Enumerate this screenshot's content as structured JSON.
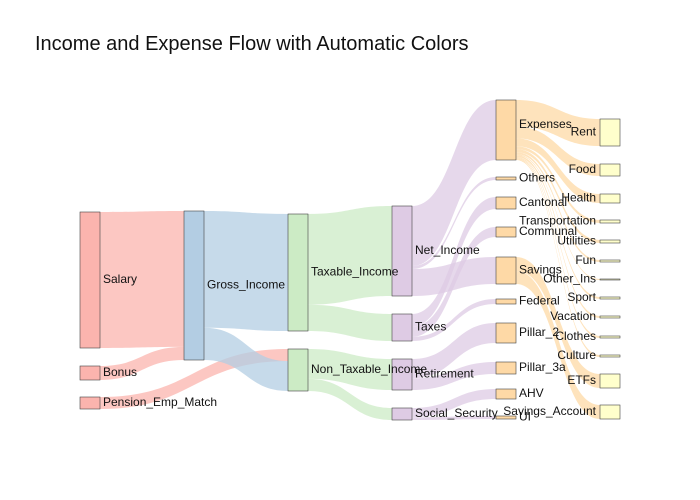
{
  "chart_data": {
    "type": "sankey",
    "title": "Income and Expense Flow with Automatic Colors",
    "nodes": [
      {
        "id": "Salary",
        "label": "Salary",
        "color": "#fbb4ae"
      },
      {
        "id": "Bonus",
        "label": "Bonus",
        "color": "#fbb4ae"
      },
      {
        "id": "Pension_Emp_Match",
        "label": "Pension_Emp_Match",
        "color": "#fbb4ae"
      },
      {
        "id": "Gross_Income",
        "label": "Gross_Income",
        "color": "#b3cde3"
      },
      {
        "id": "Taxable_Income",
        "label": "Taxable_Income",
        "color": "#ccebc5"
      },
      {
        "id": "Non_Taxable_Income",
        "label": "Non_Taxable_Income",
        "color": "#ccebc5"
      },
      {
        "id": "Net_Income",
        "label": "Net_Income",
        "color": "#decbe4"
      },
      {
        "id": "Taxes",
        "label": "Taxes",
        "color": "#decbe4"
      },
      {
        "id": "Retirement",
        "label": "Retirement",
        "color": "#decbe4"
      },
      {
        "id": "Social_Security",
        "label": "Social_Security",
        "color": "#decbe4"
      },
      {
        "id": "Expenses",
        "label": "Expenses",
        "color": "#fed9a6"
      },
      {
        "id": "Others",
        "label": "Others",
        "color": "#fed9a6"
      },
      {
        "id": "Cantonal",
        "label": "Cantonal",
        "color": "#fed9a6"
      },
      {
        "id": "Communal",
        "label": "Communal",
        "color": "#fed9a6"
      },
      {
        "id": "Savings",
        "label": "Savings",
        "color": "#fed9a6"
      },
      {
        "id": "Federal",
        "label": "Federal",
        "color": "#fed9a6"
      },
      {
        "id": "Pillar_2",
        "label": "Pillar_2",
        "color": "#fed9a6"
      },
      {
        "id": "Pillar_3a",
        "label": "Pillar_3a",
        "color": "#fed9a6"
      },
      {
        "id": "AHV",
        "label": "AHV",
        "color": "#fed9a6"
      },
      {
        "id": "UI",
        "label": "UI",
        "color": "#fed9a6"
      },
      {
        "id": "Rent",
        "label": "Rent",
        "color": "#ffffcc"
      },
      {
        "id": "Food",
        "label": "Food",
        "color": "#ffffcc"
      },
      {
        "id": "Health",
        "label": "Health",
        "color": "#ffffcc"
      },
      {
        "id": "Transportation",
        "label": "Transportation",
        "color": "#ffffcc"
      },
      {
        "id": "Utilities",
        "label": "Utilities",
        "color": "#ffffcc"
      },
      {
        "id": "Fun",
        "label": "Fun",
        "color": "#ffffcc"
      },
      {
        "id": "Other_Ins",
        "label": "Other_Ins",
        "color": "#ffffcc"
      },
      {
        "id": "Sport",
        "label": "Sport",
        "color": "#ffffcc"
      },
      {
        "id": "Vacation",
        "label": "Vacation",
        "color": "#ffffcc"
      },
      {
        "id": "Clothes",
        "label": "Clothes",
        "color": "#ffffcc"
      },
      {
        "id": "Culture",
        "label": "Culture",
        "color": "#ffffcc"
      },
      {
        "id": "ETFs",
        "label": "ETFs",
        "color": "#ffffcc"
      },
      {
        "id": "Savings_Account",
        "label": "Savings_Account",
        "color": "#ffffcc"
      }
    ],
    "links": [
      {
        "source": "Salary",
        "target": "Gross_Income",
        "value": 135
      },
      {
        "source": "Bonus",
        "target": "Gross_Income",
        "value": 13
      },
      {
        "source": "Pension_Emp_Match",
        "target": "Non_Taxable_Income",
        "value": 13
      },
      {
        "source": "Gross_Income",
        "target": "Taxable_Income",
        "value": 116
      },
      {
        "source": "Gross_Income",
        "target": "Non_Taxable_Income",
        "value": 32
      },
      {
        "source": "Taxable_Income",
        "target": "Net_Income",
        "value": 90
      },
      {
        "source": "Taxable_Income",
        "target": "Taxes",
        "value": 26
      },
      {
        "source": "Non_Taxable_Income",
        "target": "Retirement",
        "value": 32
      },
      {
        "source": "Non_Taxable_Income",
        "target": "Social_Security",
        "value": 13
      },
      {
        "source": "Net_Income",
        "target": "Expenses",
        "value": 60
      },
      {
        "source": "Net_Income",
        "target": "Others",
        "value": 3
      },
      {
        "source": "Net_Income",
        "target": "Savings",
        "value": 27
      },
      {
        "source": "Taxes",
        "target": "Cantonal",
        "value": 12
      },
      {
        "source": "Taxes",
        "target": "Communal",
        "value": 10
      },
      {
        "source": "Taxes",
        "target": "Federal",
        "value": 4
      },
      {
        "source": "Retirement",
        "target": "Pillar_2",
        "value": 20
      },
      {
        "source": "Retirement",
        "target": "Pillar_3a",
        "value": 12
      },
      {
        "source": "Social_Security",
        "target": "AHV",
        "value": 10
      },
      {
        "source": "Social_Security",
        "target": "UI",
        "value": 3
      },
      {
        "source": "Expenses",
        "target": "Rent",
        "value": 27
      },
      {
        "source": "Expenses",
        "target": "Food",
        "value": 12
      },
      {
        "source": "Expenses",
        "target": "Health",
        "value": 8
      },
      {
        "source": "Expenses",
        "target": "Transportation",
        "value": 3
      },
      {
        "source": "Expenses",
        "target": "Utilities",
        "value": 3
      },
      {
        "source": "Expenses",
        "target": "Fun",
        "value": 2
      },
      {
        "source": "Expenses",
        "target": "Other_Ins",
        "value": 1
      },
      {
        "source": "Expenses",
        "target": "Sport",
        "value": 2
      },
      {
        "source": "Expenses",
        "target": "Vacation",
        "value": 1
      },
      {
        "source": "Expenses",
        "target": "Clothes",
        "value": 1
      },
      {
        "source": "Expenses",
        "target": "Culture",
        "value": 1
      },
      {
        "source": "Savings",
        "target": "ETFs",
        "value": 14
      },
      {
        "source": "Savings",
        "target": "Savings_Account",
        "value": 13
      }
    ]
  }
}
